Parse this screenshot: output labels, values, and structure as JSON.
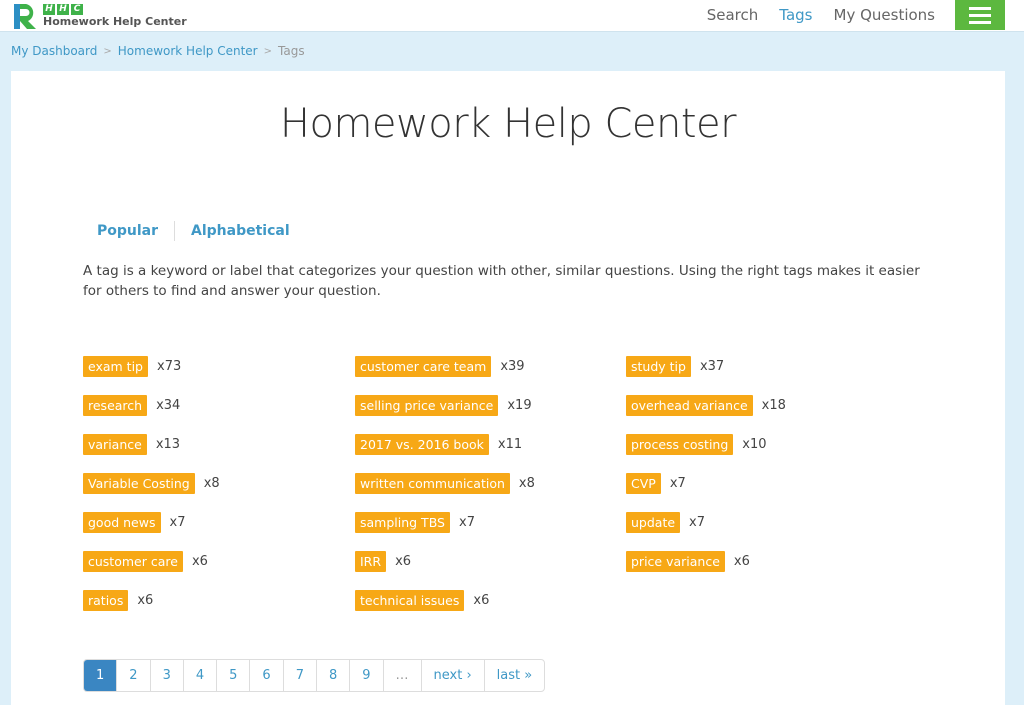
{
  "header": {
    "logo_badge": [
      "H",
      "H",
      "C"
    ],
    "logo_name": "Homework Help Center",
    "nav": [
      {
        "label": "Search",
        "active": false
      },
      {
        "label": "Tags",
        "active": true
      },
      {
        "label": "My Questions",
        "active": false
      }
    ],
    "menu_icon": "hamburger-menu-icon",
    "accent_color": "#5cb83f",
    "link_color": "#3f98c6"
  },
  "breadcrumb": [
    "My Dashboard",
    "Homework Help Center",
    "Tags"
  ],
  "main": {
    "title": "Homework Help Center",
    "tabs": [
      "Popular",
      "Alphabetical"
    ],
    "description": "A tag is a keyword or label that categorizes your question with other, similar questions. Using the right tags makes it easier for others to find and answer your question.",
    "tag_color": "#f7a816",
    "tag_columns": [
      [
        {
          "name": "exam tip",
          "count": "x73"
        },
        {
          "name": "research",
          "count": "x34"
        },
        {
          "name": "variance",
          "count": "x13"
        },
        {
          "name": "Variable Costing",
          "count": "x8"
        },
        {
          "name": "good news",
          "count": "x7"
        },
        {
          "name": "customer care",
          "count": "x6"
        },
        {
          "name": "ratios",
          "count": "x6"
        }
      ],
      [
        {
          "name": "customer care team",
          "count": "x39"
        },
        {
          "name": "selling price variance",
          "count": "x19"
        },
        {
          "name": "2017 vs. 2016 book",
          "count": "x11"
        },
        {
          "name": "written communication",
          "count": "x8"
        },
        {
          "name": "sampling TBS",
          "count": "x7"
        },
        {
          "name": "IRR",
          "count": "x6"
        },
        {
          "name": "technical issues",
          "count": "x6"
        }
      ],
      [
        {
          "name": "study tip",
          "count": "x37"
        },
        {
          "name": "overhead variance",
          "count": "x18"
        },
        {
          "name": "process costing",
          "count": "x10"
        },
        {
          "name": "CVP",
          "count": "x7"
        },
        {
          "name": "update",
          "count": "x7"
        },
        {
          "name": "price variance",
          "count": "x6"
        }
      ]
    ]
  },
  "pagination": {
    "current": "1",
    "pages": [
      "1",
      "2",
      "3",
      "4",
      "5",
      "6",
      "7",
      "8",
      "9"
    ],
    "ellipsis": "…",
    "next": "next ›",
    "last": "last »"
  }
}
